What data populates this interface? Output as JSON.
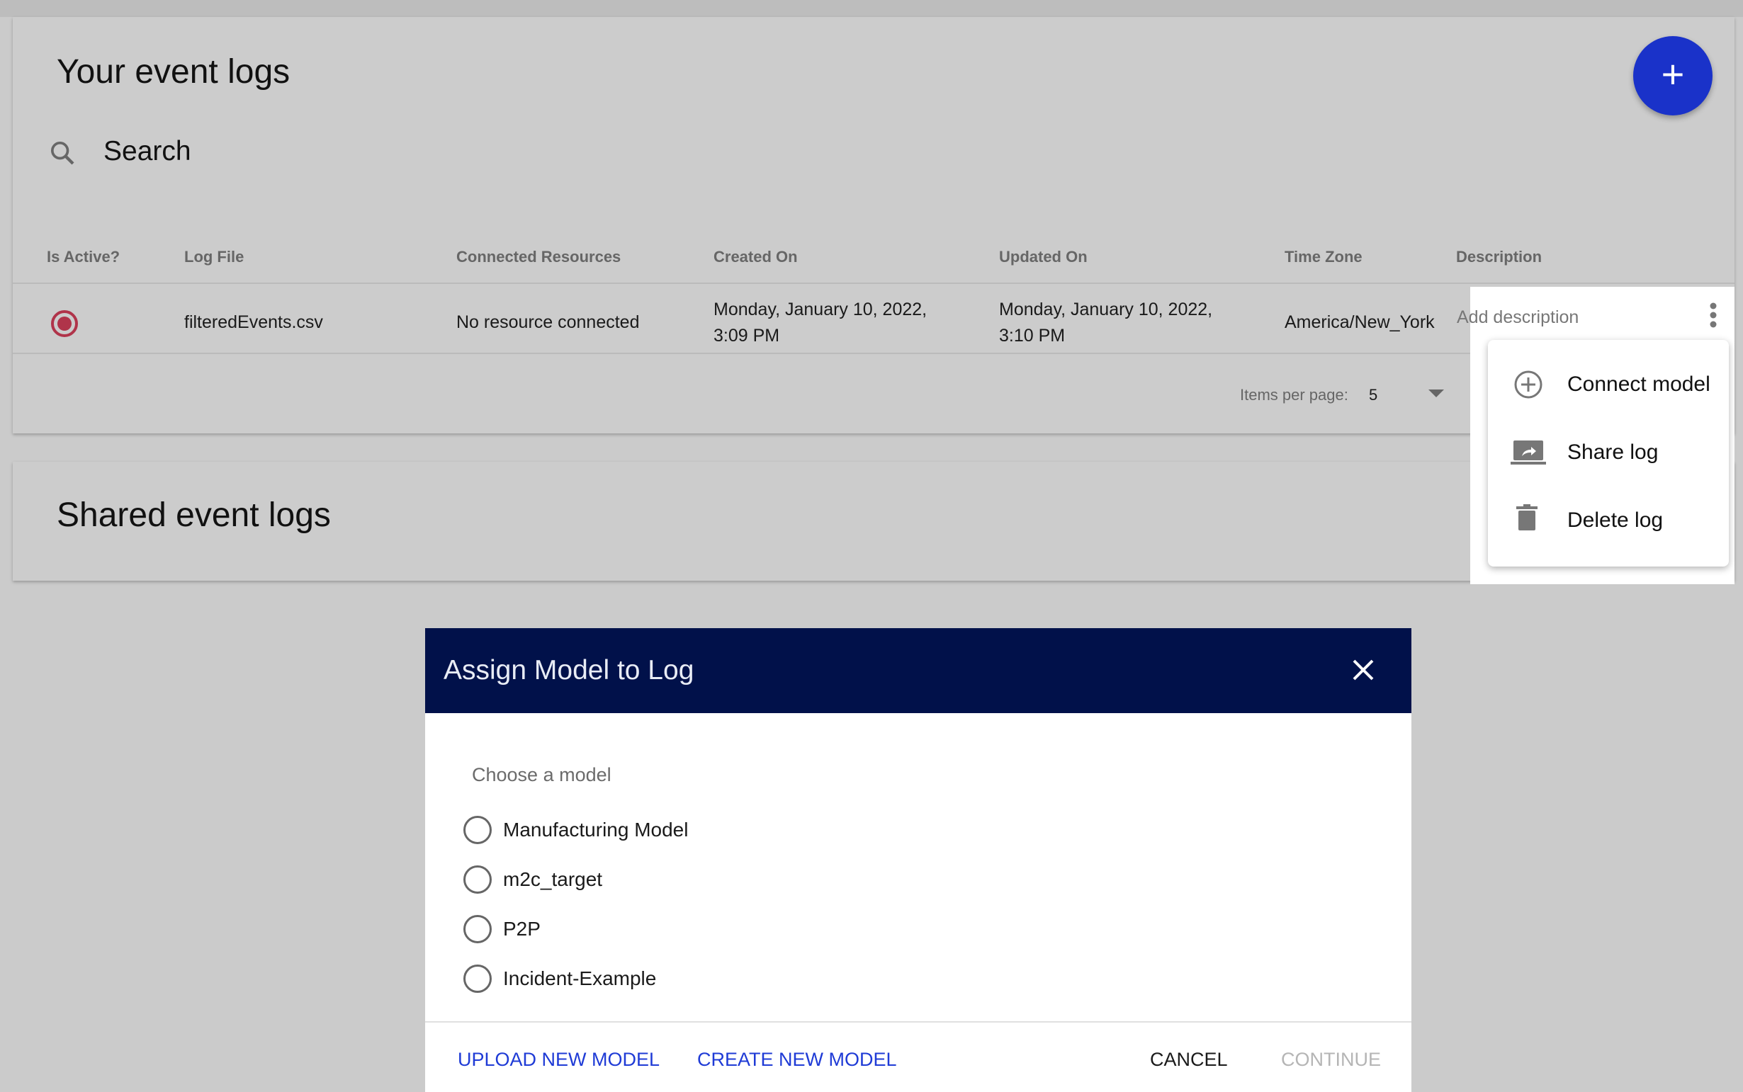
{
  "event_logs": {
    "title": "Your event logs",
    "search_label": "Search",
    "columns": [
      "Is Active?",
      "Log File",
      "Connected Resources",
      "Created On",
      "Updated On",
      "Time Zone",
      "Description"
    ],
    "rows": [
      {
        "active": true,
        "log_file": "filteredEvents.csv",
        "connected_resources": "No resource connected",
        "created_on": "Monday, January 10, 2022, 3:09 PM",
        "created_on_l1": "Monday, January 10, 2022,",
        "created_on_l2": "3:09 PM",
        "updated_on_l1": "Monday, January 10, 2022,",
        "updated_on_l2": "3:10 PM",
        "time_zone": "America/New_York",
        "description_placeholder": "Add description"
      }
    ],
    "items_per_page_label": "Items per page:",
    "items_per_page": "5",
    "fab_label": "+"
  },
  "shared_logs": {
    "title": "Shared event logs"
  },
  "row_menu": {
    "items": [
      {
        "icon": "add-circle-icon",
        "label": "Connect model"
      },
      {
        "icon": "share-screen-icon",
        "label": "Share log"
      },
      {
        "icon": "trash-icon",
        "label": "Delete log"
      }
    ]
  },
  "dialog": {
    "title": "Assign Model to Log",
    "prompt": "Choose a model",
    "options": [
      "Manufacturing Model",
      "m2c_target",
      "P2P",
      "Incident-Example"
    ],
    "buttons": {
      "upload": "UPLOAD NEW MODEL",
      "create": "CREATE NEW MODEL",
      "cancel": "CANCEL",
      "continue": "CONTINUE"
    }
  },
  "colors": {
    "accent": "#1a32c9",
    "dialog_header": "#01114a",
    "active": "#b0344a",
    "link": "#1f3bd6"
  }
}
